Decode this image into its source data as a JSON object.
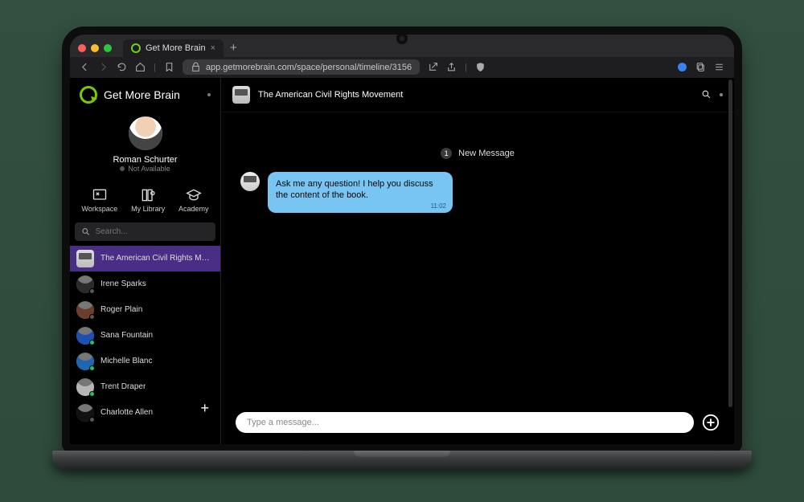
{
  "browser": {
    "tab_title": "Get More Brain",
    "url": "app.getmorebrain.com/space/personal/timeline/3156"
  },
  "sidebar": {
    "brand": "Get More Brain",
    "profile": {
      "name": "Roman Schurter",
      "status": "Not Available"
    },
    "nav": {
      "workspace": "Workspace",
      "library": "My Library",
      "academy": "Academy"
    },
    "search_placeholder": "Search...",
    "items": [
      {
        "label": "The American Civil Rights Movement",
        "kind": "book",
        "active": true
      },
      {
        "label": "Irene Sparks",
        "kind": "person",
        "presence": "off"
      },
      {
        "label": "Roger Plain",
        "kind": "person",
        "presence": "off"
      },
      {
        "label": "Sana Fountain",
        "kind": "person",
        "presence": "on"
      },
      {
        "label": "Michelle Blanc",
        "kind": "person",
        "presence": "on"
      },
      {
        "label": "Trent Draper",
        "kind": "person",
        "presence": "on"
      },
      {
        "label": "Charlotte Allen",
        "kind": "person",
        "presence": "off"
      }
    ]
  },
  "chat": {
    "header_title": "The American Civil Rights Movement",
    "new_message_badge": "1",
    "new_message_label": "New Message",
    "bubble_text": "Ask me any question! I help you discuss the content of the book.",
    "bubble_time": "11:02",
    "composer_placeholder": "Type a message..."
  }
}
